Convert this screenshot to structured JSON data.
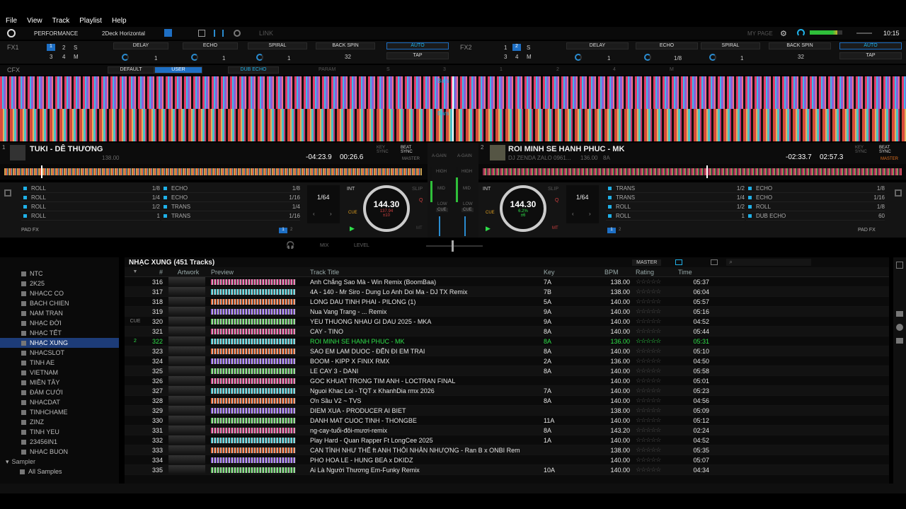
{
  "menu": [
    "File",
    "View",
    "Track",
    "Playlist",
    "Help"
  ],
  "topbar": {
    "layout": "PERFORMANCE",
    "deck_mode": "2Deck Horizontal",
    "link": "LINK",
    "my_page": "MY PAGE",
    "clock": "10:15"
  },
  "fx1": {
    "label": "FX1",
    "slots": [
      "DELAY",
      "ECHO",
      "SPIRAL"
    ],
    "slot_vals": [
      "1",
      "1",
      "1"
    ],
    "beat_fx": "BACK SPIN",
    "beat_val": "32",
    "auto": "AUTO",
    "tap": "TAP",
    "tabs": [
      "1",
      "2",
      "S",
      "3",
      "4",
      "M"
    ]
  },
  "fx2": {
    "label": "FX2",
    "slots": [
      "DELAY",
      "ECHO",
      "SPIRAL"
    ],
    "slot_vals": [
      "1",
      "1/8",
      "1"
    ],
    "beat_fx": "BACK SPIN",
    "beat_val": "32",
    "auto": "AUTO",
    "tap": "TAP",
    "tabs": [
      "1",
      "2",
      "S",
      "3",
      "4",
      "M"
    ]
  },
  "cfx": {
    "label": "CFX",
    "default": "DEFAULT",
    "user": "USER",
    "dub": "DUB ECHO",
    "param": "PARAM",
    "knobs": [
      "S",
      "3",
      "1",
      "2",
      "4",
      "M"
    ]
  },
  "wave_labels": {
    "bars": "Bars",
    "bars2": "Bars"
  },
  "deck1": {
    "num": "1",
    "title": "TUKI - DÊ THƯƠNG",
    "bpm_small": "138.00",
    "remain": "-04:23.9",
    "elapsed": "00:26.6",
    "key_sync": "KEY SYNC",
    "beat_sync": "BEAT SYNC",
    "master": "MASTER",
    "loop": "1/64",
    "int": "INT",
    "slip": "SLIP",
    "cue": "CUE",
    "jog_bpm": "144.30",
    "jog_sub1": "137.94",
    "jog_sub2": "±10",
    "pad_fx": "PAD FX",
    "mt": "MT",
    "q": "Q",
    "pads_left": [
      {
        "l": "ROLL",
        "v": "1/8"
      },
      {
        "l": "ROLL",
        "v": "1/4"
      },
      {
        "l": "ROLL",
        "v": "1/2"
      },
      {
        "l": "ROLL",
        "v": "1"
      }
    ],
    "pads_right": [
      {
        "l": "ECHO",
        "v": "1/8"
      },
      {
        "l": "ECHO",
        "v": "1/16"
      },
      {
        "l": "TRANS",
        "v": "1/4"
      },
      {
        "l": "TRANS",
        "v": "1/16"
      }
    ],
    "page": [
      "1",
      "2"
    ]
  },
  "deck2": {
    "num": "2",
    "title": "ROI MINH SE HANH PHUC - MK",
    "artist": "DJ ZENDA ZALO 0961...",
    "bpm_small": "136.00",
    "key": "8A",
    "remain": "-02:33.7",
    "elapsed": "02:57.3",
    "key_sync": "KEY SYNC",
    "beat_sync": "BEAT SYNC",
    "master": "MASTER",
    "loop": "1/64",
    "int": "INT",
    "slip": "SLIP",
    "cue": "CUE",
    "jog_bpm": "144.30",
    "jog_sub1": "6.2%",
    "jog_sub2": "±6",
    "pad_fx": "PAD FX",
    "mt": "MT",
    "q": "Q",
    "pads_left": [
      {
        "l": "TRANS",
        "v": "1/2"
      },
      {
        "l": "TRANS",
        "v": "1/4"
      },
      {
        "l": "ROLL",
        "v": "1/2"
      },
      {
        "l": "ROLL",
        "v": "1"
      }
    ],
    "pads_right": [
      {
        "l": "ECHO",
        "v": "1/8"
      },
      {
        "l": "ECHO",
        "v": "1/16"
      },
      {
        "l": "ROLL",
        "v": "1/8"
      },
      {
        "l": "DUB ECHO",
        "v": "60"
      }
    ],
    "page": [
      "1",
      "2"
    ]
  },
  "mixer": {
    "again1": "A-GAIN",
    "again2": "A-GAIN",
    "high": "HIGH",
    "mid": "MID",
    "low": "LOW",
    "cue": "CUE"
  },
  "phones": {
    "mix": "MIX",
    "level": "LEVEL"
  },
  "sidebar": {
    "items": [
      "NTC",
      "2K25",
      "NHACC CO",
      "BACH CHIEN",
      "NAM TRAN",
      "NHẠC ĐỜI",
      "NHẠC TẾT",
      "NHẠC XUNG",
      "NHACSLOT",
      "TINH AE",
      "VIETNAM",
      "MIỀN TÂY",
      "ĐÁM CƯỚI",
      "NHACDAT",
      "TINHCHAME",
      "ZINZ",
      "TINH YEU",
      "23456IN1",
      "NHAC BUON"
    ],
    "selected": 7,
    "sampler": "Sampler",
    "all_samples": "All Samples"
  },
  "browser": {
    "title": "NHẠC XUNG (451 Tracks)",
    "master": "MASTER",
    "columns": {
      "num": "#",
      "art": "Artwork",
      "preview": "Preview",
      "title": "Track Title",
      "key": "Key",
      "bpm": "BPM",
      "rating": "Rating",
      "time": "Time"
    },
    "rows": [
      {
        "n": "316",
        "t": "Anh Chẳng Sao Mà - Win Remix (BoomBaa)",
        "k": "7A",
        "b": "138.00",
        "d": "05:37"
      },
      {
        "n": "317",
        "t": "4A - 140 - Mr Siro - Dung Lo Anh Doi Ma  - DJ TX Remix",
        "k": "7B",
        "b": "138.00",
        "d": "06:04"
      },
      {
        "n": "318",
        "t": "LONG DAU TINH PHAI - PILONG (1)",
        "k": "5A",
        "b": "140.00",
        "d": "05:57"
      },
      {
        "n": "319",
        "t": "Nua Vang Trang - ... Remix",
        "k": "9A",
        "b": "140.00",
        "d": "05:16"
      },
      {
        "n": "320",
        "f": "CUE",
        "t": "YEU THUONG NHAU GI DAU 2025 - MKA",
        "k": "9A",
        "b": "140.00",
        "d": "04:52"
      },
      {
        "n": "321",
        "t": "CAY - TINO",
        "k": "8A",
        "b": "140.00",
        "d": "05:44"
      },
      {
        "n": "322",
        "f": "2",
        "t": "ROI MINH SE HANH PHUC - MK",
        "k": "8A",
        "b": "136.00",
        "d": "05:31",
        "hl": true
      },
      {
        "n": "323",
        "t": "SAO EM LAM DUOC - ĐẾN ĐI EM TRAI",
        "k": "8A",
        "b": "140.00",
        "d": "05:10"
      },
      {
        "n": "324",
        "t": "BOOM - KIPP X FINIX RMX",
        "k": "2A",
        "b": "136.00",
        "d": "04:50"
      },
      {
        "n": "325",
        "t": "LE CAY 3 - DANI",
        "k": "8A",
        "b": "140.00",
        "d": "05:58"
      },
      {
        "n": "326",
        "t": "GOC KHUAT TRONG TIM ANH - LOCTRAN FINAL",
        "k": "",
        "b": "140.00",
        "d": "05:01"
      },
      {
        "n": "327",
        "t": "Nguoi Khac Loi - TQT x KhanhDia rmx 2026",
        "k": "7A",
        "b": "140.00",
        "d": "05:23"
      },
      {
        "n": "328",
        "t": "Ơn Sầu V2 ~ TVS",
        "k": "8A",
        "b": "140.00",
        "d": "04:56"
      },
      {
        "n": "329",
        "t": "DIEM XUA - PRODUCER AI BIET",
        "k": "",
        "b": "138.00",
        "d": "05:09"
      },
      {
        "n": "330",
        "t": "DANH MAT CUOC TINH - THONGBE",
        "k": "11A",
        "b": "140.00",
        "d": "05:12"
      },
      {
        "n": "331",
        "t": "ng-cay-tuổi-đôi-mươi-remix",
        "k": "8A",
        "b": "143.20",
        "d": "02:24"
      },
      {
        "n": "332",
        "t": "Play Hard - Quan Rapper Ft LongCee 2025",
        "k": "1A",
        "b": "140.00",
        "d": "04:52"
      },
      {
        "n": "333",
        "t": "CẠN TÌNH NHƯ THẾ ft ANH THÔI NHÂN NHƯỢNG - Ran B x ONBI Rem",
        "k": "",
        "b": "138.00",
        "d": "05:35"
      },
      {
        "n": "334",
        "t": "PHO HOA LE - HUNG BEA x DKIDZ",
        "k": "",
        "b": "140.00",
        "d": "05:07"
      },
      {
        "n": "335",
        "t": "Ai Là Người Thương Em-Funky Remix",
        "k": "10A",
        "b": "140.00",
        "d": "04:34"
      }
    ],
    "stars": "☆☆☆☆☆"
  },
  "colors": {
    "accent": "#1fb1e8",
    "highlight": "#2fe04a",
    "sel": "#1d3c78"
  }
}
